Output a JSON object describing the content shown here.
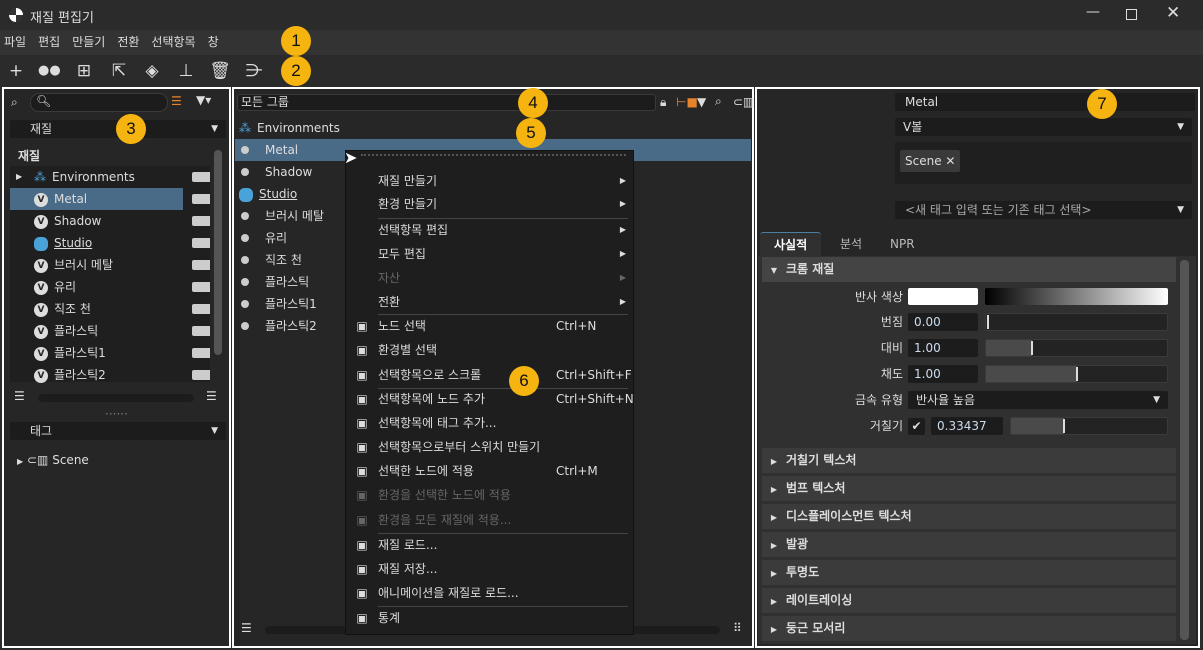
{
  "window": {
    "title": "재질 편집기"
  },
  "menubar": [
    "파일",
    "편집",
    "만들기",
    "전환",
    "선택항목",
    "창"
  ],
  "toolbar": [
    "add-icon",
    "dual-circle-icon",
    "select-grid-icon",
    "select-node-icon",
    "apply-bucket-icon",
    "brush-icon",
    "trash-icon",
    "node-graph-icon"
  ],
  "left": {
    "search_placeholder": "",
    "library_dropdown": "재질",
    "tree_header": "재질",
    "items": [
      {
        "label": "Environments",
        "type": "environment"
      },
      {
        "label": "Metal",
        "type": "v",
        "selected": true
      },
      {
        "label": "Shadow",
        "type": "v"
      },
      {
        "label": "Studio",
        "type": "studio"
      },
      {
        "label": "브러시 메탈",
        "type": "v"
      },
      {
        "label": "유리",
        "type": "v"
      },
      {
        "label": "직조 천",
        "type": "v"
      },
      {
        "label": "플라스틱",
        "type": "v"
      },
      {
        "label": "플라스틱1",
        "type": "v"
      },
      {
        "label": "플라스틱2",
        "type": "v"
      }
    ],
    "tags_dropdown": "태그",
    "tags": [
      "Scene"
    ]
  },
  "middle": {
    "group_field": "모든 그룹",
    "items": [
      {
        "label": "Environments",
        "type": "environment"
      },
      {
        "label": "Metal",
        "selected": true
      },
      {
        "label": "Shadow"
      },
      {
        "label": "Studio",
        "type": "studio"
      },
      {
        "label": "브러시 메탈"
      },
      {
        "label": "유리"
      },
      {
        "label": "직조 천"
      },
      {
        "label": "플라스틱"
      },
      {
        "label": "플라스틱1"
      },
      {
        "label": "플라스틱2"
      }
    ]
  },
  "context_menu": [
    {
      "label": "재질 만들기",
      "submenu": true
    },
    {
      "label": "환경 만들기",
      "submenu": true
    },
    {
      "label": "선택항목 편집",
      "submenu": true
    },
    {
      "label": "모두 편집",
      "submenu": true
    },
    {
      "label": "자산",
      "submenu": true,
      "disabled": true
    },
    {
      "label": "전환",
      "submenu": true
    },
    {
      "label": "노드 선택",
      "shortcut": "Ctrl+N",
      "icon": "select-node-icon"
    },
    {
      "label": "환경별 선택",
      "icon": "select-by-env-icon"
    },
    {
      "label": "선택항목으로 스크롤",
      "shortcut": "Ctrl+Shift+F",
      "icon": "scroll-icon"
    },
    {
      "label": "선택항목에 노드 추가",
      "shortcut": "Ctrl+Shift+N",
      "icon": "add-node-icon"
    },
    {
      "label": "선택항목에 태그 추가...",
      "icon": "tag-icon"
    },
    {
      "label": "선택항목으로부터 스위치 만들기",
      "icon": "switch-icon"
    },
    {
      "label": "선택한 노드에 적용",
      "shortcut": "Ctrl+M",
      "icon": "apply-bucket-icon"
    },
    {
      "label": "환경을 선택한 노드에 적용",
      "disabled": true,
      "icon": "env-apply-icon"
    },
    {
      "label": "환경을 모든 재질에 적용...",
      "disabled": true,
      "icon": "env-apply-all-icon"
    },
    {
      "label": "재질 로드...",
      "icon": "load-icon"
    },
    {
      "label": "재질 저장...",
      "icon": "save-icon"
    },
    {
      "label": "애니메이션을 재질로 로드...",
      "icon": "animation-icon"
    },
    {
      "label": "통계",
      "icon": "stats-icon"
    }
  ],
  "right": {
    "name": "Metal",
    "type_dropdown": "V볼",
    "tag_chip": "Scene",
    "tag_input_placeholder": "<새 태그 입력 또는 기존 태그 선택>",
    "tabs": [
      "사실적",
      "분석",
      "NPR"
    ],
    "active_tab": "사실적",
    "section": "크롬 재질",
    "props": {
      "reflect_color_label": "반사 색상",
      "reflect_color": "#ffffff",
      "blur_label": "번짐",
      "blur": "0.00",
      "contrast_label": "대비",
      "contrast": "1.00",
      "saturation_label": "채도",
      "saturation": "1.00",
      "metal_type_label": "금속 유형",
      "metal_type": "반사율 높음",
      "roughness_label": "거칠기",
      "roughness_enabled": true,
      "roughness": "0.33437"
    },
    "collapsed_sections": [
      "거칠기 텍스처",
      "범프 텍스처",
      "디스플레이스먼트 텍스처",
      "발광",
      "투명도",
      "레이트레이싱",
      "둥근 모서리"
    ]
  },
  "annotations": [
    "1",
    "2",
    "3",
    "4",
    "5",
    "6",
    "7"
  ],
  "colors": {
    "selection": "#4a6b88",
    "badge": "#f5b40f",
    "accent": "#e8852b"
  }
}
